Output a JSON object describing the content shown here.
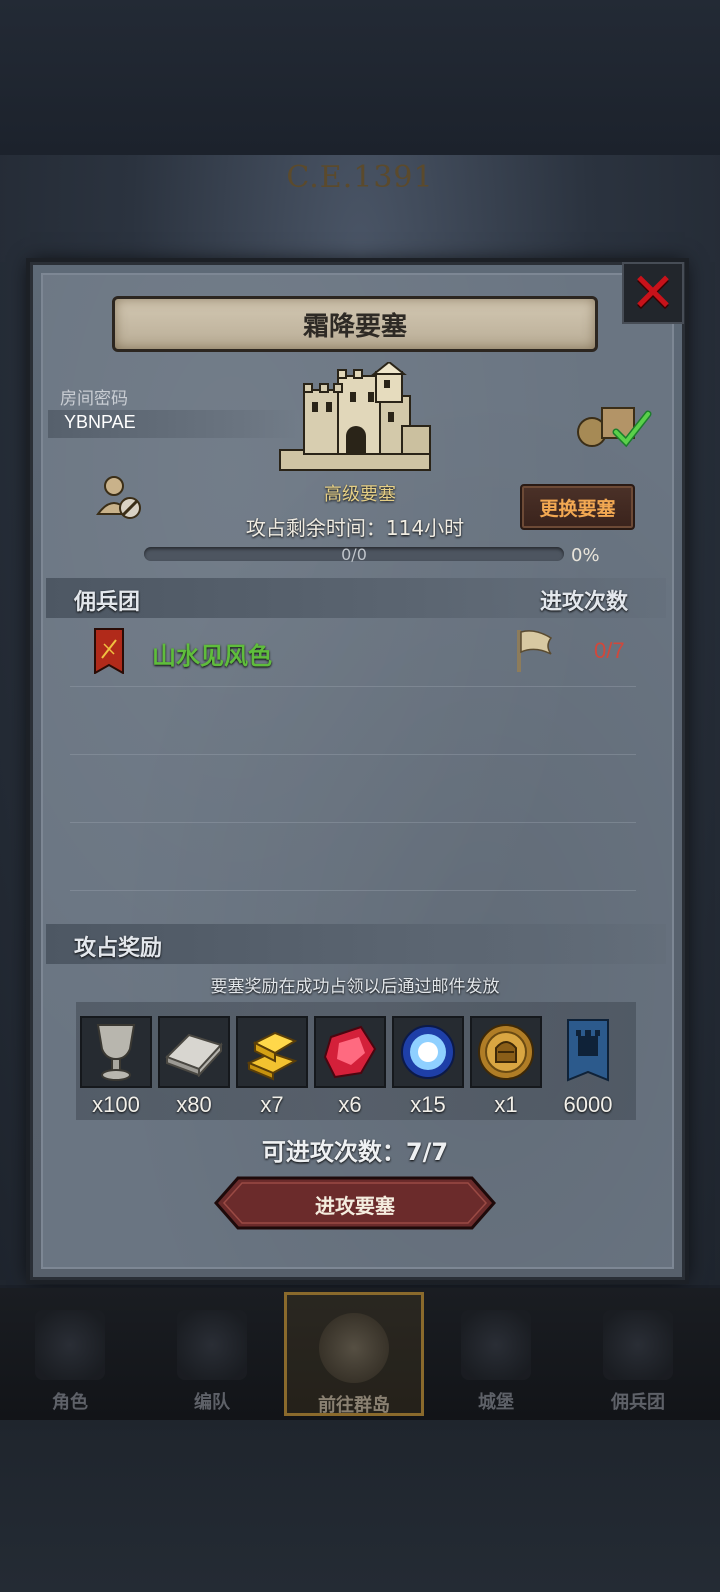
{
  "era": "C.E.1391",
  "dialog": {
    "title": "霜降要塞",
    "close_icon": "close-icon",
    "room_password_label": "房间密码",
    "room_password": "YBNPAE",
    "fortress_level": "高级要塞",
    "change_button": "更换要塞",
    "remaining_time_label": "攻占剩余时间：",
    "remaining_time_value": "114小时",
    "progress_text": "0/0",
    "progress_percent": "0%",
    "progress_fraction": 0,
    "mercenary_header": "佣兵团",
    "attack_count_header": "进攻次数",
    "mercenaries": [
      {
        "name": "山水见风色",
        "attacks": "0/7"
      }
    ],
    "reward_header": "攻占奖励",
    "reward_note": "要塞奖励在成功占领以后通过邮件发放",
    "rewards": [
      {
        "icon": "chalice-icon",
        "qty": "x100"
      },
      {
        "icon": "iron-ingot-icon",
        "qty": "x80"
      },
      {
        "icon": "gold-bars-icon",
        "qty": "x7"
      },
      {
        "icon": "ruby-icon",
        "qty": "x6"
      },
      {
        "icon": "blue-orb-icon",
        "qty": "x15"
      },
      {
        "icon": "knight-medal-icon",
        "qty": "x1"
      },
      {
        "icon": "fortress-banner-icon",
        "qty": "6000"
      }
    ],
    "available_attacks": "可进攻次数：7/7",
    "attack_button": "进攻要塞"
  },
  "nav": {
    "items": [
      {
        "label": "角色",
        "icon": "knight-icon",
        "active": false
      },
      {
        "label": "编队",
        "icon": "helmet-icon",
        "active": false
      },
      {
        "label": "前往群岛",
        "icon": "compass-map-icon",
        "active": true
      },
      {
        "label": "城堡",
        "icon": "castle-icon",
        "active": false
      },
      {
        "label": "佣兵团",
        "icon": "ship-icon",
        "active": false
      }
    ]
  },
  "colors": {
    "guild_name": "#5fbd3c",
    "attack_count": "#d0483c",
    "change_button_text": "#f2a852",
    "fortress_level": "#e5cf86",
    "close": "#c8121a"
  }
}
